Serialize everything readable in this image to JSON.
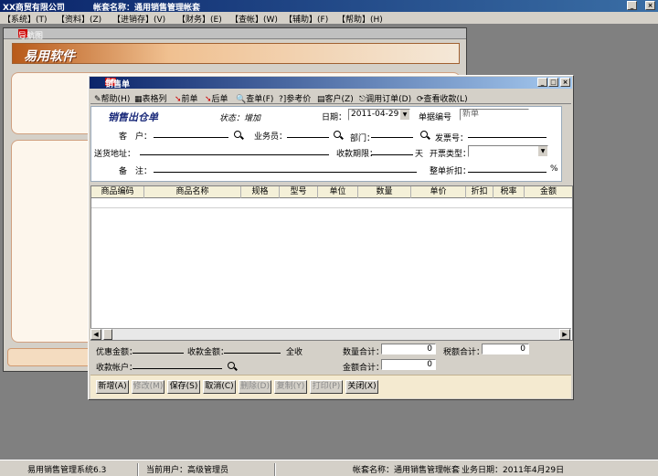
{
  "app": {
    "company": "XX商贸有限公司",
    "account_title": "帐套名称：通用销售管理帐套",
    "win_min": "_",
    "win_restore": "□",
    "win_close": "×"
  },
  "menu": [
    "【系统】(T)",
    "【资料】(Z)",
    "【进销存】(V)",
    "【财务】(E)",
    "【查帐】(W)",
    "【辅助】(F)",
    "【帮助】(H)"
  ],
  "nav_window": {
    "title": "导航图",
    "brand": "易用软件"
  },
  "sales_window": {
    "logo": "易用",
    "title": "销售单",
    "toolbar": [
      "帮助(H)",
      "表格列",
      "前单",
      "后单",
      "查单(F)",
      "?]参考价",
      "客户(Z)",
      "调用订单(D)",
      "查看收款(L)"
    ],
    "form": {
      "heading": "销售出仓单",
      "status": "状态：增加",
      "date_label": "日期：",
      "date_value": "2011-04-29",
      "doc_no_label": "单据编号",
      "doc_no_value": "新单",
      "customer_label": "客　户：",
      "salesman_label": "业务员：",
      "dept_label": "部门：",
      "invoice_label": "发票号：",
      "address_label": "送货地址：",
      "due_label": "收款期限：",
      "days_unit": "天",
      "invoice_type_label": "开票类型：",
      "remark_label": "备　注：",
      "discount_label": "整单折扣：",
      "percent": "%"
    },
    "grid_columns": [
      "商品编码",
      "商品名称",
      "规格",
      "型号",
      "单位",
      "数量",
      "单价",
      "折扣",
      "税率",
      "金额"
    ],
    "summary": {
      "promo_label": "优惠金额：",
      "received_label": "收款金额：",
      "full_receive": "全收",
      "qty_total_label": "数量合计：",
      "qty_total": "0",
      "tax_total_label": "税额合计：",
      "tax_total": "0",
      "account_label": "收款帐户：",
      "amount_total_label": "金额合计：",
      "amount_total": "0"
    },
    "buttons": [
      "新增(A)",
      "修改(M)",
      "保存(S)",
      "取消(C)",
      "删除(D)",
      "复制(Y)",
      "打印(P)",
      "关闭(X)"
    ]
  },
  "statusbar": {
    "system": "易用销售管理系统6.3",
    "user": "当前用户：高级管理员",
    "account": "帐套名称：通用销售管理帐套",
    "biz_date": "业务日期：2011年4月29日"
  }
}
